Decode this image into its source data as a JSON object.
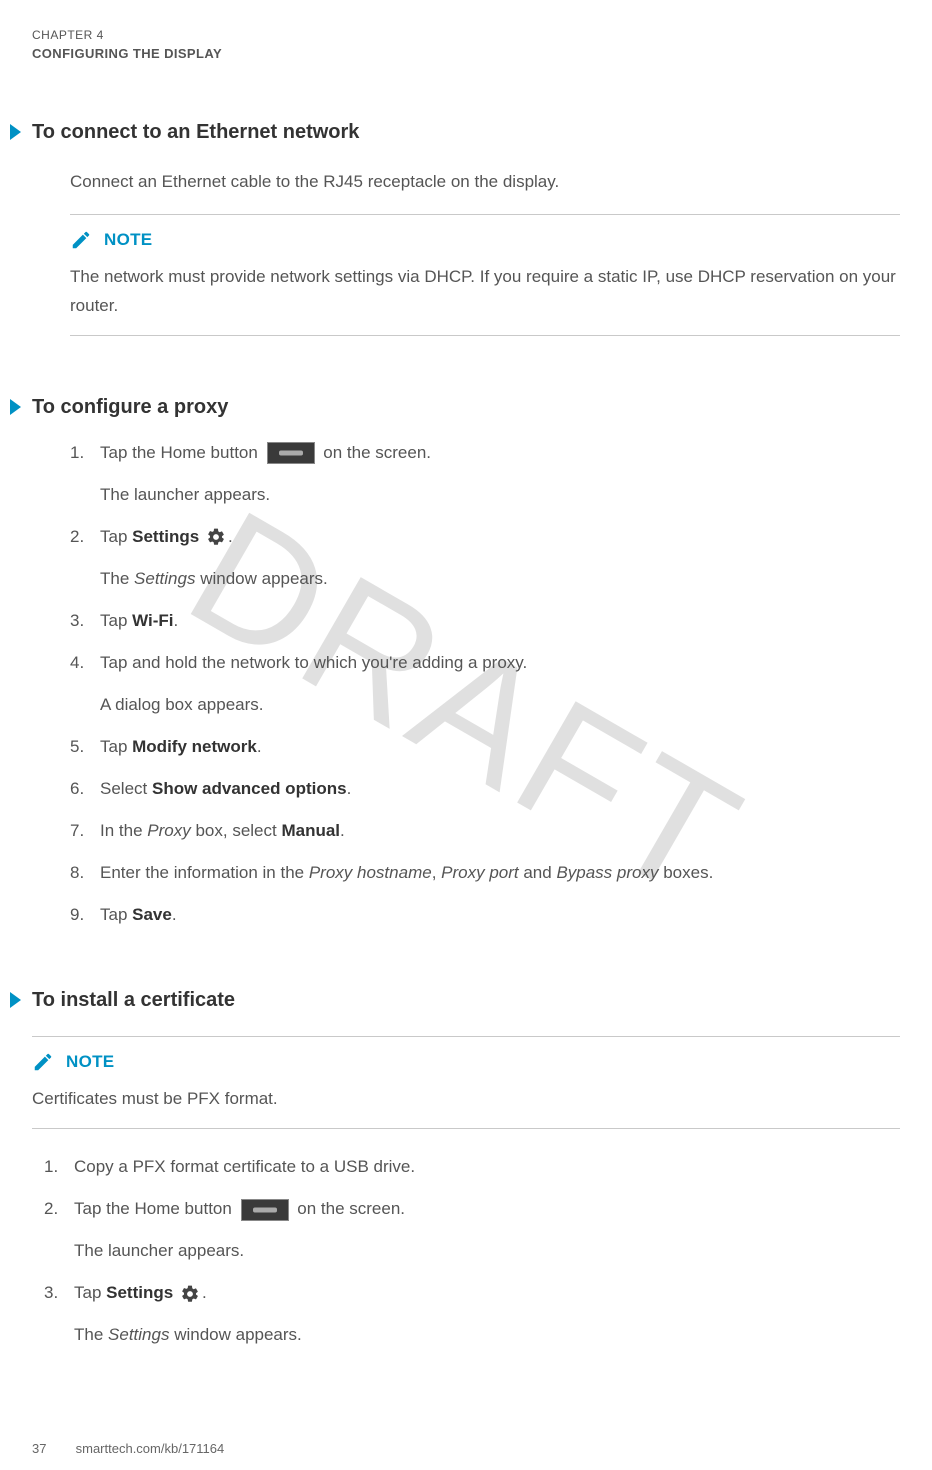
{
  "header": {
    "chapter": "CHAPTER 4",
    "title": "CONFIGURING THE DISPLAY"
  },
  "watermark": "DRAFT",
  "note_label": "NOTE",
  "sections": {
    "ethernet": {
      "heading": "To connect to an Ethernet network",
      "body": "Connect an Ethernet cable to the RJ45 receptacle on the display.",
      "note": "The network must provide network settings via DHCP. If you require a static IP, use DHCP reservation on your router."
    },
    "proxy": {
      "heading": "To configure a proxy",
      "steps": {
        "s1a": "Tap the Home button ",
        "s1b": " on the screen.",
        "s1after": "The launcher appears.",
        "s2a": "Tap ",
        "s2bold": "Settings",
        "s2b": " ",
        "s2c": ".",
        "s2after_a": "The ",
        "s2after_i": "Settings",
        "s2after_b": " window appears.",
        "s3a": "Tap ",
        "s3bold": "Wi-Fi",
        "s3b": ".",
        "s4": "Tap and hold the network to which you're adding a proxy.",
        "s4after": "A dialog box appears.",
        "s5a": "Tap ",
        "s5bold": "Modify network",
        "s5b": ".",
        "s6a": "Select ",
        "s6bold": "Show advanced options",
        "s6b": ".",
        "s7a": "In the ",
        "s7i": "Proxy",
        "s7b": " box, select ",
        "s7bold": "Manual",
        "s7c": ".",
        "s8a": "Enter the information in the ",
        "s8i1": "Proxy hostname",
        "s8b": ", ",
        "s8i2": "Proxy port",
        "s8c": " and ",
        "s8i3": "Bypass proxy",
        "s8d": " boxes.",
        "s9a": "Tap ",
        "s9bold": "Save",
        "s9b": "."
      }
    },
    "cert": {
      "heading": "To install a certificate",
      "note": "Certificates must be PFX format.",
      "steps": {
        "s1": "Copy a PFX format certificate to a USB drive.",
        "s2a": "Tap the Home button ",
        "s2b": " on the screen.",
        "s2after": "The launcher appears.",
        "s3a": "Tap ",
        "s3bold": "Settings",
        "s3b": " ",
        "s3c": ".",
        "s3after_a": "The ",
        "s3after_i": "Settings",
        "s3after_b": " window appears."
      }
    }
  },
  "footer": {
    "page": "37",
    "url": "smarttech.com/kb/171164"
  }
}
